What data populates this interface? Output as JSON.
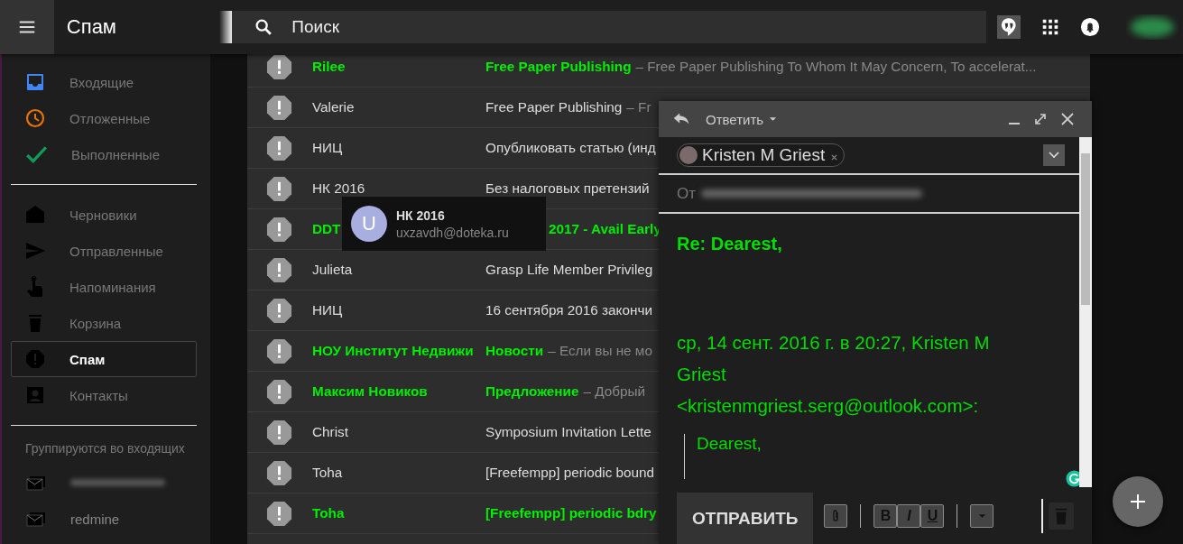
{
  "topbar": {
    "title": "Спам",
    "search": {
      "placeholder": "Поиск"
    }
  },
  "sidebar": {
    "sections": [
      {
        "items": [
          {
            "kind": "inbox",
            "label": "Входящие",
            "selected": false
          },
          {
            "kind": "snoozed",
            "label": "Отложенные",
            "selected": false
          },
          {
            "kind": "done",
            "label": "Выполненные",
            "selected": false
          }
        ]
      },
      {
        "items": [
          {
            "kind": "drafts",
            "label": "Черновики",
            "selected": false
          },
          {
            "kind": "sent",
            "label": "Отправленные",
            "selected": false
          },
          {
            "kind": "reminders",
            "label": "Напоминания",
            "selected": false
          },
          {
            "kind": "trash",
            "label": "Корзина",
            "selected": false
          },
          {
            "kind": "spam",
            "label": "Спам",
            "selected": true
          },
          {
            "kind": "contacts",
            "label": "Контакты",
            "selected": false
          }
        ]
      }
    ],
    "groups_heading": "Группируются во входящих",
    "groups": [
      {
        "kind": "redacted"
      },
      {
        "kind": "label",
        "label": "redmine"
      }
    ]
  },
  "messages": [
    {
      "sender": "Rilee",
      "subject": "Free Paper Publishing",
      "snippet": "– Free Paper Publishing To Whom It May Concern, To accelerat...",
      "unread": true
    },
    {
      "sender": "Valerie",
      "subject": "Free Paper Publishing",
      "snippet": "– Fr",
      "unread": false
    },
    {
      "sender": "НИЦ",
      "subject": "Опубликовать статью (инд",
      "unread": false
    },
    {
      "sender": "НК 2016",
      "subject": "Без налоговых претензий",
      "unread": false
    },
    {
      "sender": "DDT",
      "subject": "2017 - Avail Early",
      "unread": true
    },
    {
      "sender": "Julieta",
      "subject": "Grasp Life Member Privileg",
      "unread": false
    },
    {
      "sender": "НИЦ",
      "subject": "16 сентября 2016 закончи",
      "unread": false
    },
    {
      "sender": "НОУ Институт Недвижи",
      "subject": "Новости",
      "snippet": "– Если вы не мо",
      "unread": true
    },
    {
      "sender": "Максим Новиков",
      "subject": "Предложение",
      "snippet": "– Добрый",
      "unread": true
    },
    {
      "sender": "Christ",
      "subject": "Symposium Invitation Lette",
      "unread": false
    },
    {
      "sender": "Toha",
      "subject": "[Freefempp] periodic bound",
      "unread": false
    },
    {
      "sender": "Toha",
      "subject": "[Freefempp] periodic bdry",
      "unread": true
    }
  ],
  "contact_card": {
    "initial": "U",
    "name": "НК 2016",
    "email": "uxzavdh@doteka.ru"
  },
  "compose": {
    "mode": "Ответить",
    "recipients": [
      {
        "name": "Kristen M Griest"
      }
    ],
    "from_label": "От",
    "subject": "Re: Dearest,",
    "quote_header": "ср, 14 сент. 2016 г. в 20:27, Kristen M Griest <kristenmgriest.serg@outlook.com>:",
    "quote": "Dearest,",
    "send": "ОТПРАВИТЬ",
    "format_buttons": [
      {
        "kind": "bold",
        "label": "B"
      },
      {
        "kind": "italic",
        "label": "I"
      },
      {
        "kind": "underline",
        "label": "U"
      }
    ]
  }
}
